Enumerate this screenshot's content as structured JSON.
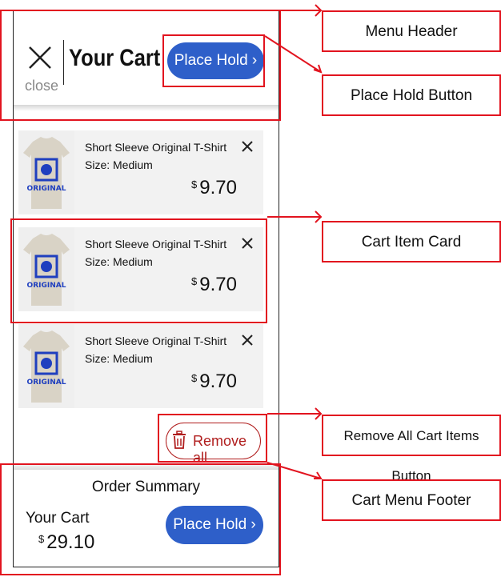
{
  "header": {
    "close_label": "close",
    "title": "Your Cart",
    "place_hold_label": "Place Hold ›"
  },
  "cart_items": [
    {
      "name": "Short Sleeve Original T-Shirt",
      "size": "Size: Medium",
      "currency": "$",
      "price": "9.70",
      "image_text": "ORIGINAL"
    },
    {
      "name": "Short Sleeve Original T-Shirt",
      "size": "Size: Medium",
      "currency": "$",
      "price": "9.70",
      "image_text": "ORIGINAL"
    },
    {
      "name": "Short Sleeve Original T-Shirt",
      "size": "Size: Medium",
      "currency": "$",
      "price": "9.70",
      "image_text": "ORIGINAL"
    }
  ],
  "remove_all_label": "Remove all",
  "footer": {
    "title": "Order Summary",
    "cart_label": "Your Cart",
    "currency": "$",
    "total": "29.10",
    "place_hold_label": "Place Hold ›"
  },
  "annotations": {
    "menu_header": "Menu Header",
    "place_hold_button": "Place Hold Button",
    "cart_item_card": "Cart Item Card",
    "remove_all_button": "Remove All Cart Items Button",
    "cart_menu_footer": "Cart Menu Footer"
  },
  "colors": {
    "accent_blue": "#2e5fc9",
    "annotation_red": "#e2141f",
    "remove_red": "#b01d1d"
  }
}
